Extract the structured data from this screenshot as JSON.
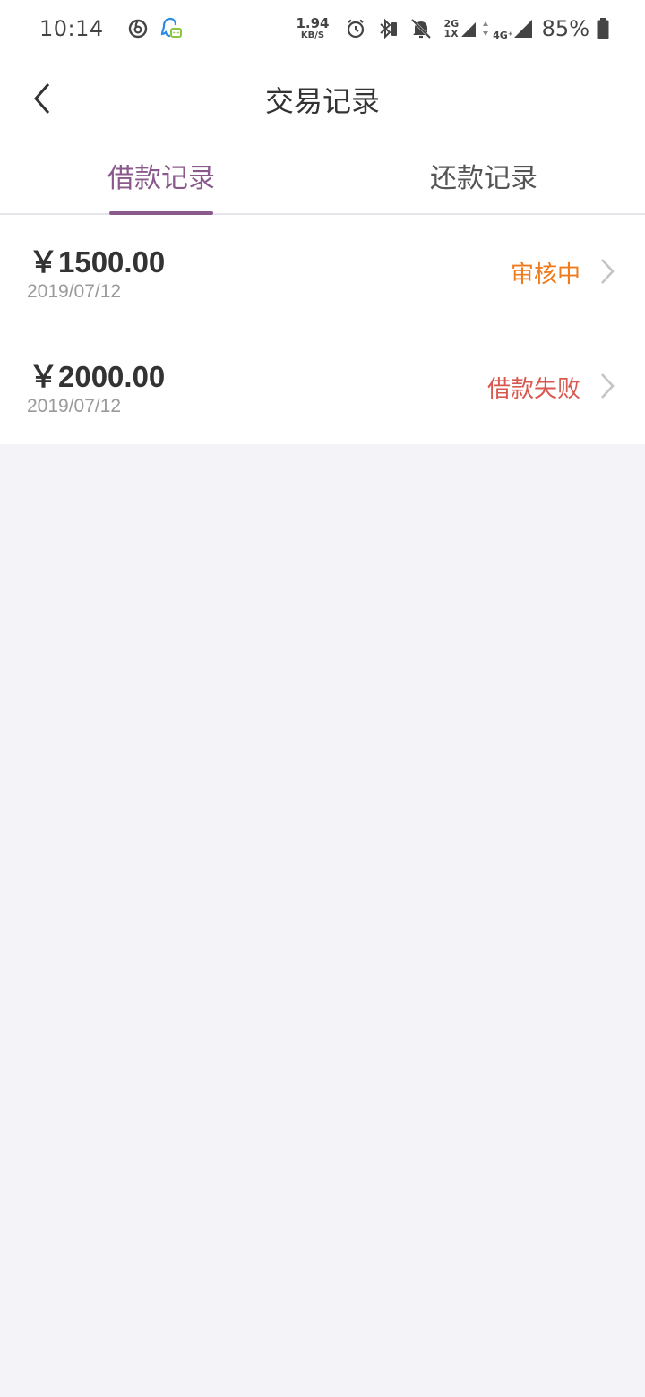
{
  "status_bar": {
    "time": "10:14",
    "speed_value": "1.94",
    "speed_unit": "KB/S",
    "net1_top": "2G",
    "net1_bottom": "1X",
    "net2_top": "4G⁺",
    "battery": "85%",
    "icons": [
      "netease-music-icon",
      "qq-icon",
      "alarm-icon",
      "bluetooth-icon",
      "mute-bell-icon",
      "signal-icon",
      "battery-icon"
    ]
  },
  "header": {
    "title": "交易记录",
    "back_icon": "chevron-left-icon"
  },
  "tabs": [
    {
      "label": "借款记录",
      "active": true
    },
    {
      "label": "还款记录",
      "active": false
    }
  ],
  "records": [
    {
      "amount": "￥1500.00",
      "date": "2019/07/12",
      "status": "审核中",
      "status_color": "#f07b1c"
    },
    {
      "amount": "￥2000.00",
      "date": "2019/07/12",
      "status": "借款失败",
      "status_color": "#d9584f"
    }
  ],
  "colors": {
    "accent": "#8a5a8c",
    "background": "#f3f3f8"
  }
}
